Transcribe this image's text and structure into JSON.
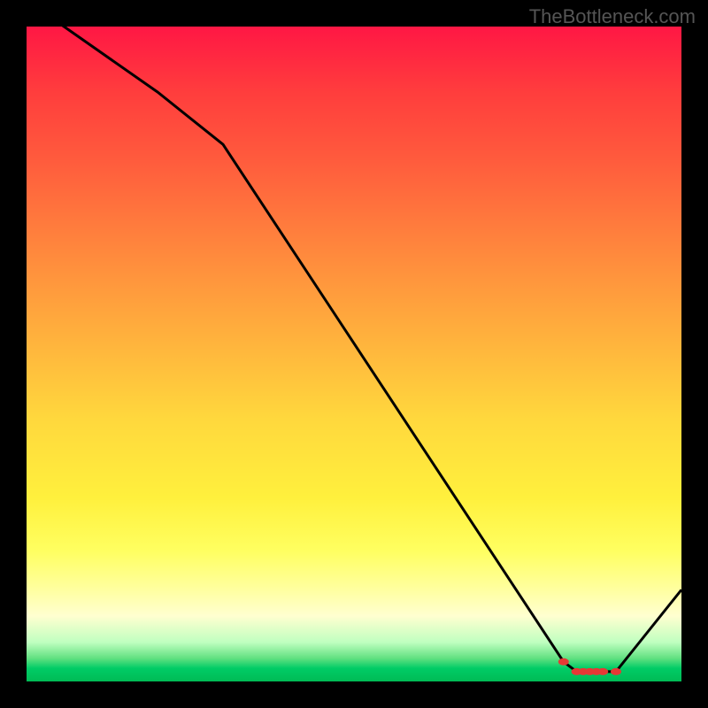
{
  "watermark": "TheBottleneck.com",
  "chart_data": {
    "type": "line",
    "title": "",
    "xlabel": "",
    "ylabel": "",
    "x": [
      0,
      20,
      30,
      82,
      84,
      85,
      86,
      87,
      88,
      90,
      100
    ],
    "values": [
      104,
      90,
      82,
      3,
      1.5,
      1.5,
      1.5,
      1.5,
      1.5,
      1.5,
      14
    ],
    "ylim": [
      0,
      100
    ],
    "xlim": [
      0,
      100
    ],
    "marker_indexes": [
      3,
      4,
      5,
      6,
      7,
      8,
      9
    ],
    "marker_color": "#e53935",
    "line_color": "#000000"
  }
}
